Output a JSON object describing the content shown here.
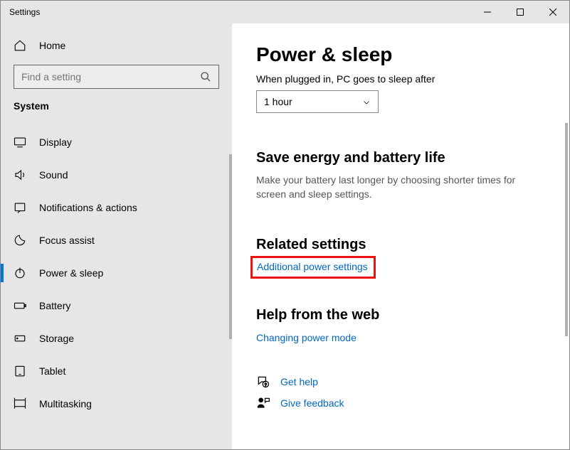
{
  "window": {
    "title": "Settings"
  },
  "sidebar": {
    "home_label": "Home",
    "search_placeholder": "Find a setting",
    "section_label": "System",
    "items": [
      {
        "label": "Display",
        "selected": false
      },
      {
        "label": "Sound",
        "selected": false
      },
      {
        "label": "Notifications & actions",
        "selected": false
      },
      {
        "label": "Focus assist",
        "selected": false
      },
      {
        "label": "Power & sleep",
        "selected": true
      },
      {
        "label": "Battery",
        "selected": false
      },
      {
        "label": "Storage",
        "selected": false
      },
      {
        "label": "Tablet",
        "selected": false
      },
      {
        "label": "Multitasking",
        "selected": false
      }
    ]
  },
  "main": {
    "title": "Power & sleep",
    "plugged_in_label": "When plugged in, PC goes to sleep after",
    "dropdown_value": "1 hour",
    "save_energy_heading": "Save energy and battery life",
    "save_energy_desc": "Make your battery last longer by choosing shorter times for screen and sleep settings.",
    "related_heading": "Related settings",
    "additional_power_link": "Additional power settings",
    "help_heading": "Help from the web",
    "changing_power_link": "Changing power mode",
    "get_help_link": "Get help",
    "give_feedback_link": "Give feedback"
  }
}
